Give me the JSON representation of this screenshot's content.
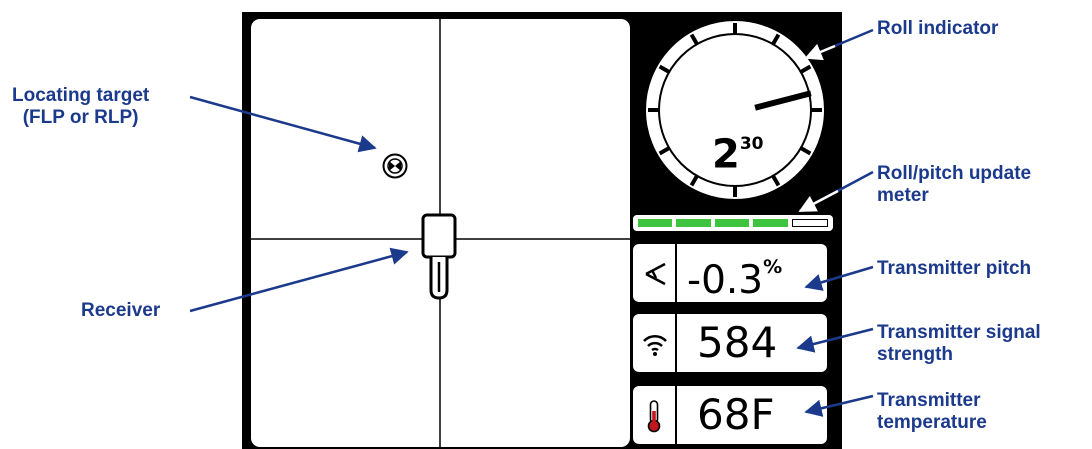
{
  "callouts": {
    "roll_indicator": "Roll indicator",
    "locating_target": [
      "Locating target",
      "(FLP or RLP)"
    ],
    "roll_pitch_meter": [
      "Roll/pitch update",
      "meter"
    ],
    "receiver": "Receiver",
    "transmitter_pitch": "Transmitter pitch",
    "signal_strength": [
      "Transmitter signal",
      "strength"
    ],
    "temperature": [
      "Transmitter",
      "temperature"
    ]
  },
  "display": {
    "roll": {
      "main": "2",
      "sup": "30"
    },
    "pitch": {
      "value": "-0.3",
      "unit": "%"
    },
    "signal": {
      "value": "584"
    },
    "temperature": {
      "value": "68F"
    },
    "update_meter": {
      "filled_segments": 4,
      "total_segments": 5
    }
  },
  "colors": {
    "callout_text": "#1c3a8c",
    "meter_fill": "#3ec43e",
    "thermometer": "#c0181e"
  },
  "icons": [
    "locating-target-icon",
    "receiver-icon",
    "pitch-icon",
    "signal-strength-icon",
    "thermometer-icon"
  ]
}
